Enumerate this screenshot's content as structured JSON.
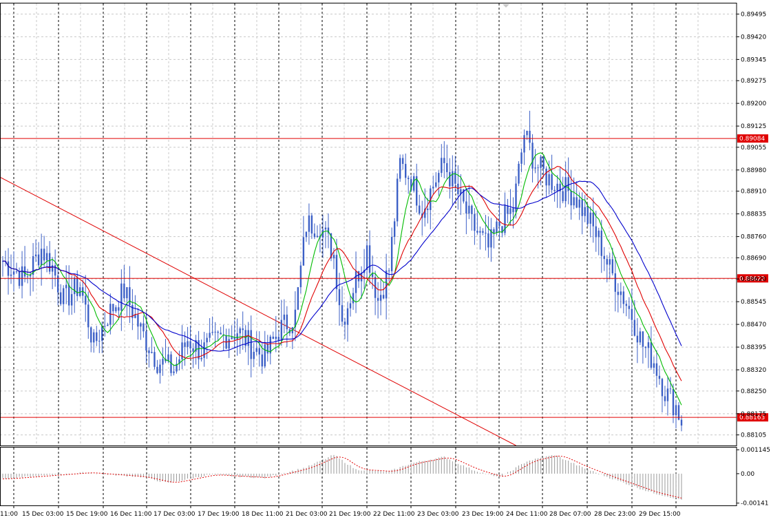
{
  "chart_data": [
    {
      "type": "candlestick",
      "timeframe_note": "hourly bars",
      "x_tick_labels": [
        "11:00",
        "15 Dec 03:00",
        "15 Dec 19:00",
        "16 Dec 11:00",
        "17 Dec 03:00",
        "17 Dec 19:00",
        "18 Dec 11:00",
        "21 Dec 03:00",
        "21 Dec 19:00",
        "22 Dec 11:00",
        "23 Dec 03:00",
        "23 Dec 19:00",
        "24 Dec 11:00",
        "28 Dec 07:00",
        "28 Dec 23:00",
        "29 Dec 15:00"
      ],
      "y_tick_labels": [
        "0.89495",
        "0.89420",
        "0.89345",
        "0.89275",
        "0.89200",
        "0.89125",
        "0.89055",
        "0.88980",
        "0.88910",
        "0.88835",
        "0.88760",
        "0.88690",
        "0.88620",
        "0.88545",
        "0.88470",
        "0.88395",
        "0.88320",
        "0.88250",
        "0.88175",
        "0.88105"
      ],
      "ylim": [
        0.8807,
        0.8953
      ],
      "horizontal_levels": [
        {
          "label": "0.89084",
          "value": 0.89084,
          "color": "#e00000"
        },
        {
          "label": "0.88622",
          "value": 0.88622,
          "color": "#e00000"
        },
        {
          "label": "0.88163",
          "value": 0.88163,
          "color": "#e00000"
        }
      ],
      "trendline": {
        "color": "#e00000",
        "from": {
          "bar": 0,
          "value": 0.88955
        },
        "to": {
          "bar": 186,
          "value": 0.8807
        }
      },
      "series_colors": {
        "candles": "#3b5fc6",
        "ma_fast": "#00bb00",
        "ma_mid": "#e00000",
        "ma_slow": "#0000cc"
      },
      "price_anchors": [
        [
          0,
          0.8868
        ],
        [
          8,
          0.8862
        ],
        [
          14,
          0.8872
        ],
        [
          18,
          0.8866
        ],
        [
          22,
          0.8855
        ],
        [
          28,
          0.886
        ],
        [
          33,
          0.884
        ],
        [
          38,
          0.885
        ],
        [
          44,
          0.8858
        ],
        [
          50,
          0.8845
        ],
        [
          56,
          0.8835
        ],
        [
          62,
          0.8832
        ],
        [
          67,
          0.8842
        ],
        [
          72,
          0.8838
        ],
        [
          78,
          0.8842
        ],
        [
          85,
          0.8845
        ],
        [
          90,
          0.884
        ],
        [
          95,
          0.8836
        ],
        [
          100,
          0.8845
        ],
        [
          106,
          0.885
        ],
        [
          110,
          0.888
        ],
        [
          115,
          0.888
        ],
        [
          120,
          0.887
        ],
        [
          123,
          0.8848
        ],
        [
          128,
          0.8862
        ],
        [
          132,
          0.8872
        ],
        [
          136,
          0.8855
        ],
        [
          140,
          0.8865
        ],
        [
          144,
          0.89
        ],
        [
          148,
          0.8895
        ],
        [
          152,
          0.8885
        ],
        [
          157,
          0.8895
        ],
        [
          160,
          0.89
        ],
        [
          165,
          0.889
        ],
        [
          170,
          0.888
        ],
        [
          176,
          0.8872
        ],
        [
          180,
          0.888
        ],
        [
          185,
          0.8885
        ],
        [
          189,
          0.891
        ],
        [
          193,
          0.89
        ],
        [
          198,
          0.8895
        ],
        [
          203,
          0.8892
        ],
        [
          207,
          0.889
        ],
        [
          212,
          0.8882
        ],
        [
          216,
          0.8875
        ],
        [
          220,
          0.8865
        ],
        [
          224,
          0.8858
        ],
        [
          228,
          0.885
        ],
        [
          232,
          0.884
        ],
        [
          236,
          0.8835
        ],
        [
          240,
          0.8825
        ],
        [
          244,
          0.882
        ],
        [
          246,
          0.8815
        ]
      ],
      "oscillator": {
        "y_tick_labels": [
          "0.001145",
          "0.00",
          "-0.00141"
        ],
        "ylim": [
          -0.00152,
          0.00125
        ],
        "signal_color": "#e00000",
        "histogram_color": "#999999",
        "anchors": [
          [
            0,
            -0.00025
          ],
          [
            30,
            5e-05
          ],
          [
            50,
            -0.00015
          ],
          [
            60,
            -0.00045
          ],
          [
            75,
            -5e-05
          ],
          [
            95,
            -0.0002
          ],
          [
            110,
            0.0003
          ],
          [
            120,
            0.0009
          ],
          [
            128,
            0.0002
          ],
          [
            140,
            0.0001
          ],
          [
            148,
            0.0005
          ],
          [
            160,
            0.0008
          ],
          [
            170,
            0.0002
          ],
          [
            180,
            -0.0002
          ],
          [
            190,
            0.0006
          ],
          [
            200,
            0.0009
          ],
          [
            210,
            0.0003
          ],
          [
            220,
            -0.0002
          ],
          [
            235,
            -0.0009
          ],
          [
            246,
            -0.00125
          ]
        ]
      }
    }
  ]
}
